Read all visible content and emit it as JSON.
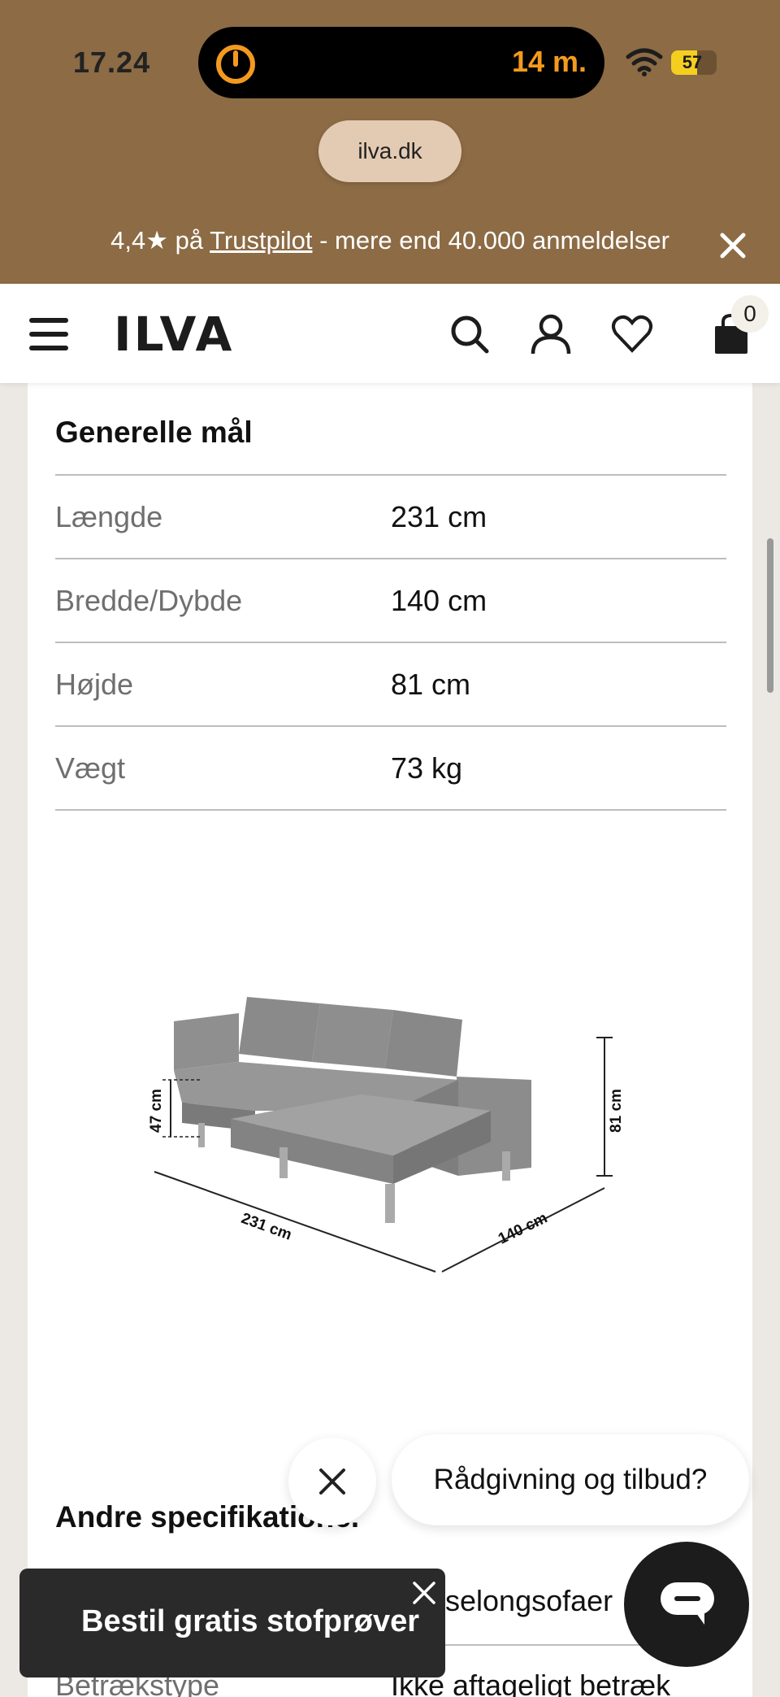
{
  "status_bar": {
    "time": "17.24",
    "live_activity_time": "14 m.",
    "battery_level": "57"
  },
  "browser": {
    "url": "ilva.dk"
  },
  "promo_banner": {
    "rating_prefix": "4,4★ på ",
    "rating_link": "Trustpilot",
    "rating_suffix": " - mere end 40.000 anmeldelser"
  },
  "header": {
    "logo": "ILVA",
    "cart_count": "0"
  },
  "general_dimensions": {
    "title": "Generelle mål",
    "rows": [
      {
        "label": "Længde",
        "value": "231 cm"
      },
      {
        "label": "Bredde/Dybde",
        "value": "140 cm"
      },
      {
        "label": "Højde",
        "value": "81 cm"
      },
      {
        "label": "Vægt",
        "value": "73 kg"
      }
    ]
  },
  "diagram": {
    "seat_height": "47 cm",
    "length": "231 cm",
    "depth": "140 cm",
    "height": "81 cm"
  },
  "other_specs": {
    "title": "Andre specifikatione.",
    "row1_value": "selongsofaer",
    "row2_label": "Betrækstype",
    "row2_value": "Ikke aftageligt betræk"
  },
  "chat": {
    "prompt": "Rådgivning og tilbud?"
  },
  "sample_banner": {
    "label": "Bestil gratis stofprøver"
  }
}
